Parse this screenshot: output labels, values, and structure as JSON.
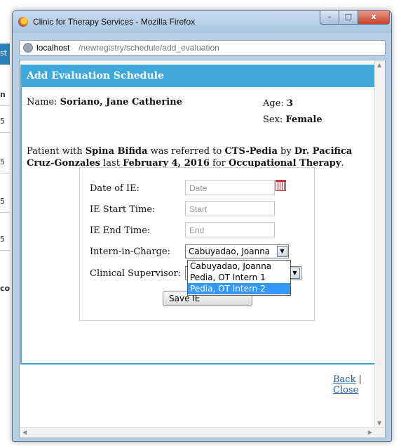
{
  "window": {
    "title": "Clinic for Therapy Services - Mozilla Firefox",
    "url_host": "localhost",
    "url_path": "/newregistry/schedule/add_evaluation",
    "controls": {
      "minimize": "–",
      "maximize": "□",
      "close": "x"
    }
  },
  "background_page": {
    "letters": [
      "st",
      "n",
      "5",
      "5",
      "5",
      "5",
      "co"
    ]
  },
  "dialog": {
    "title": "Add Evaluation Schedule",
    "name_label": "Name:",
    "name_value": "Soriano, Jane Catherine",
    "age_label": "Age:",
    "age_value": "3",
    "sex_label": "Sex:",
    "sex_value": "Female",
    "referral": {
      "t1": "Patient with ",
      "diagnosis": "Spina Bifida",
      "t2": " was referred to ",
      "service": "CTS-Pedia",
      "t3": " by ",
      "doctor_line1": "Dr. Pacifica",
      "doctor_line2": "Cruz-Gonzales",
      "t4": " last ",
      "date": "February 4, 2016",
      "t5": " for ",
      "therapy": "Occupational Therapy",
      "t6": "."
    },
    "form": {
      "date_label": "Date of IE:",
      "date_placeholder": "Date",
      "start_label": "IE Start Time:",
      "start_placeholder": "Start",
      "end_label": "IE End Time:",
      "end_placeholder": "End",
      "intern_label": "Intern-in-Charge:",
      "intern_selected": "Cabuyadao, Joanna",
      "supervisor_label": "Clinical Supervisor:",
      "save_label": "Save IE",
      "dropdown_options": [
        "Cabuyadao, Joanna",
        "Pedia, OT Intern 1",
        "Pedia, OT Intern 2"
      ],
      "dropdown_highlighted": "Pedia, OT Intern 2"
    }
  },
  "links": {
    "back": "Back",
    "separator": " | ",
    "close": "Close"
  }
}
